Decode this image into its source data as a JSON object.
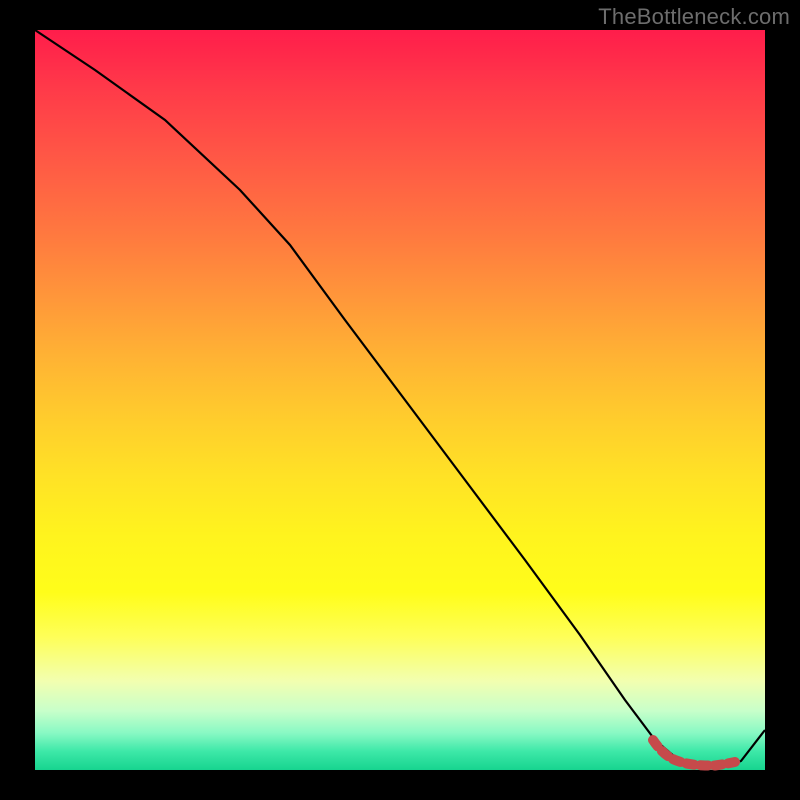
{
  "watermark": "TheBottleneck.com",
  "chart_data": {
    "type": "line",
    "title": "",
    "xlabel": "",
    "ylabel": "",
    "x": [
      0.0,
      0.05,
      0.1,
      0.15,
      0.2,
      0.25,
      0.3,
      0.35,
      0.4,
      0.45,
      0.5,
      0.55,
      0.6,
      0.65,
      0.7,
      0.75,
      0.8,
      0.82,
      0.85,
      0.88,
      0.9,
      0.92,
      0.94,
      0.96,
      1.0
    ],
    "series": [
      {
        "name": "main-curve",
        "color": "#000000",
        "values": [
          1.0,
          0.95,
          0.9,
          0.86,
          0.82,
          0.78,
          0.72,
          0.64,
          0.56,
          0.48,
          0.4,
          0.32,
          0.24,
          0.17,
          0.11,
          0.06,
          0.02,
          0.01,
          0.005,
          0.003,
          0.003,
          0.003,
          0.005,
          0.02,
          0.08
        ]
      },
      {
        "name": "highlight-segment",
        "color": "#c64a4b",
        "values": [
          null,
          null,
          null,
          null,
          null,
          null,
          null,
          null,
          null,
          null,
          null,
          null,
          null,
          null,
          null,
          null,
          0.02,
          0.01,
          0.005,
          0.003,
          0.003,
          0.003,
          null,
          null,
          null
        ]
      }
    ],
    "xlim": [
      0,
      1
    ],
    "ylim": [
      0,
      1
    ],
    "grid": false,
    "legend": false
  },
  "colors": {
    "background": "#000000",
    "watermark": "#6d6d6d",
    "curve": "#000000",
    "highlight": "#c64a4b"
  }
}
